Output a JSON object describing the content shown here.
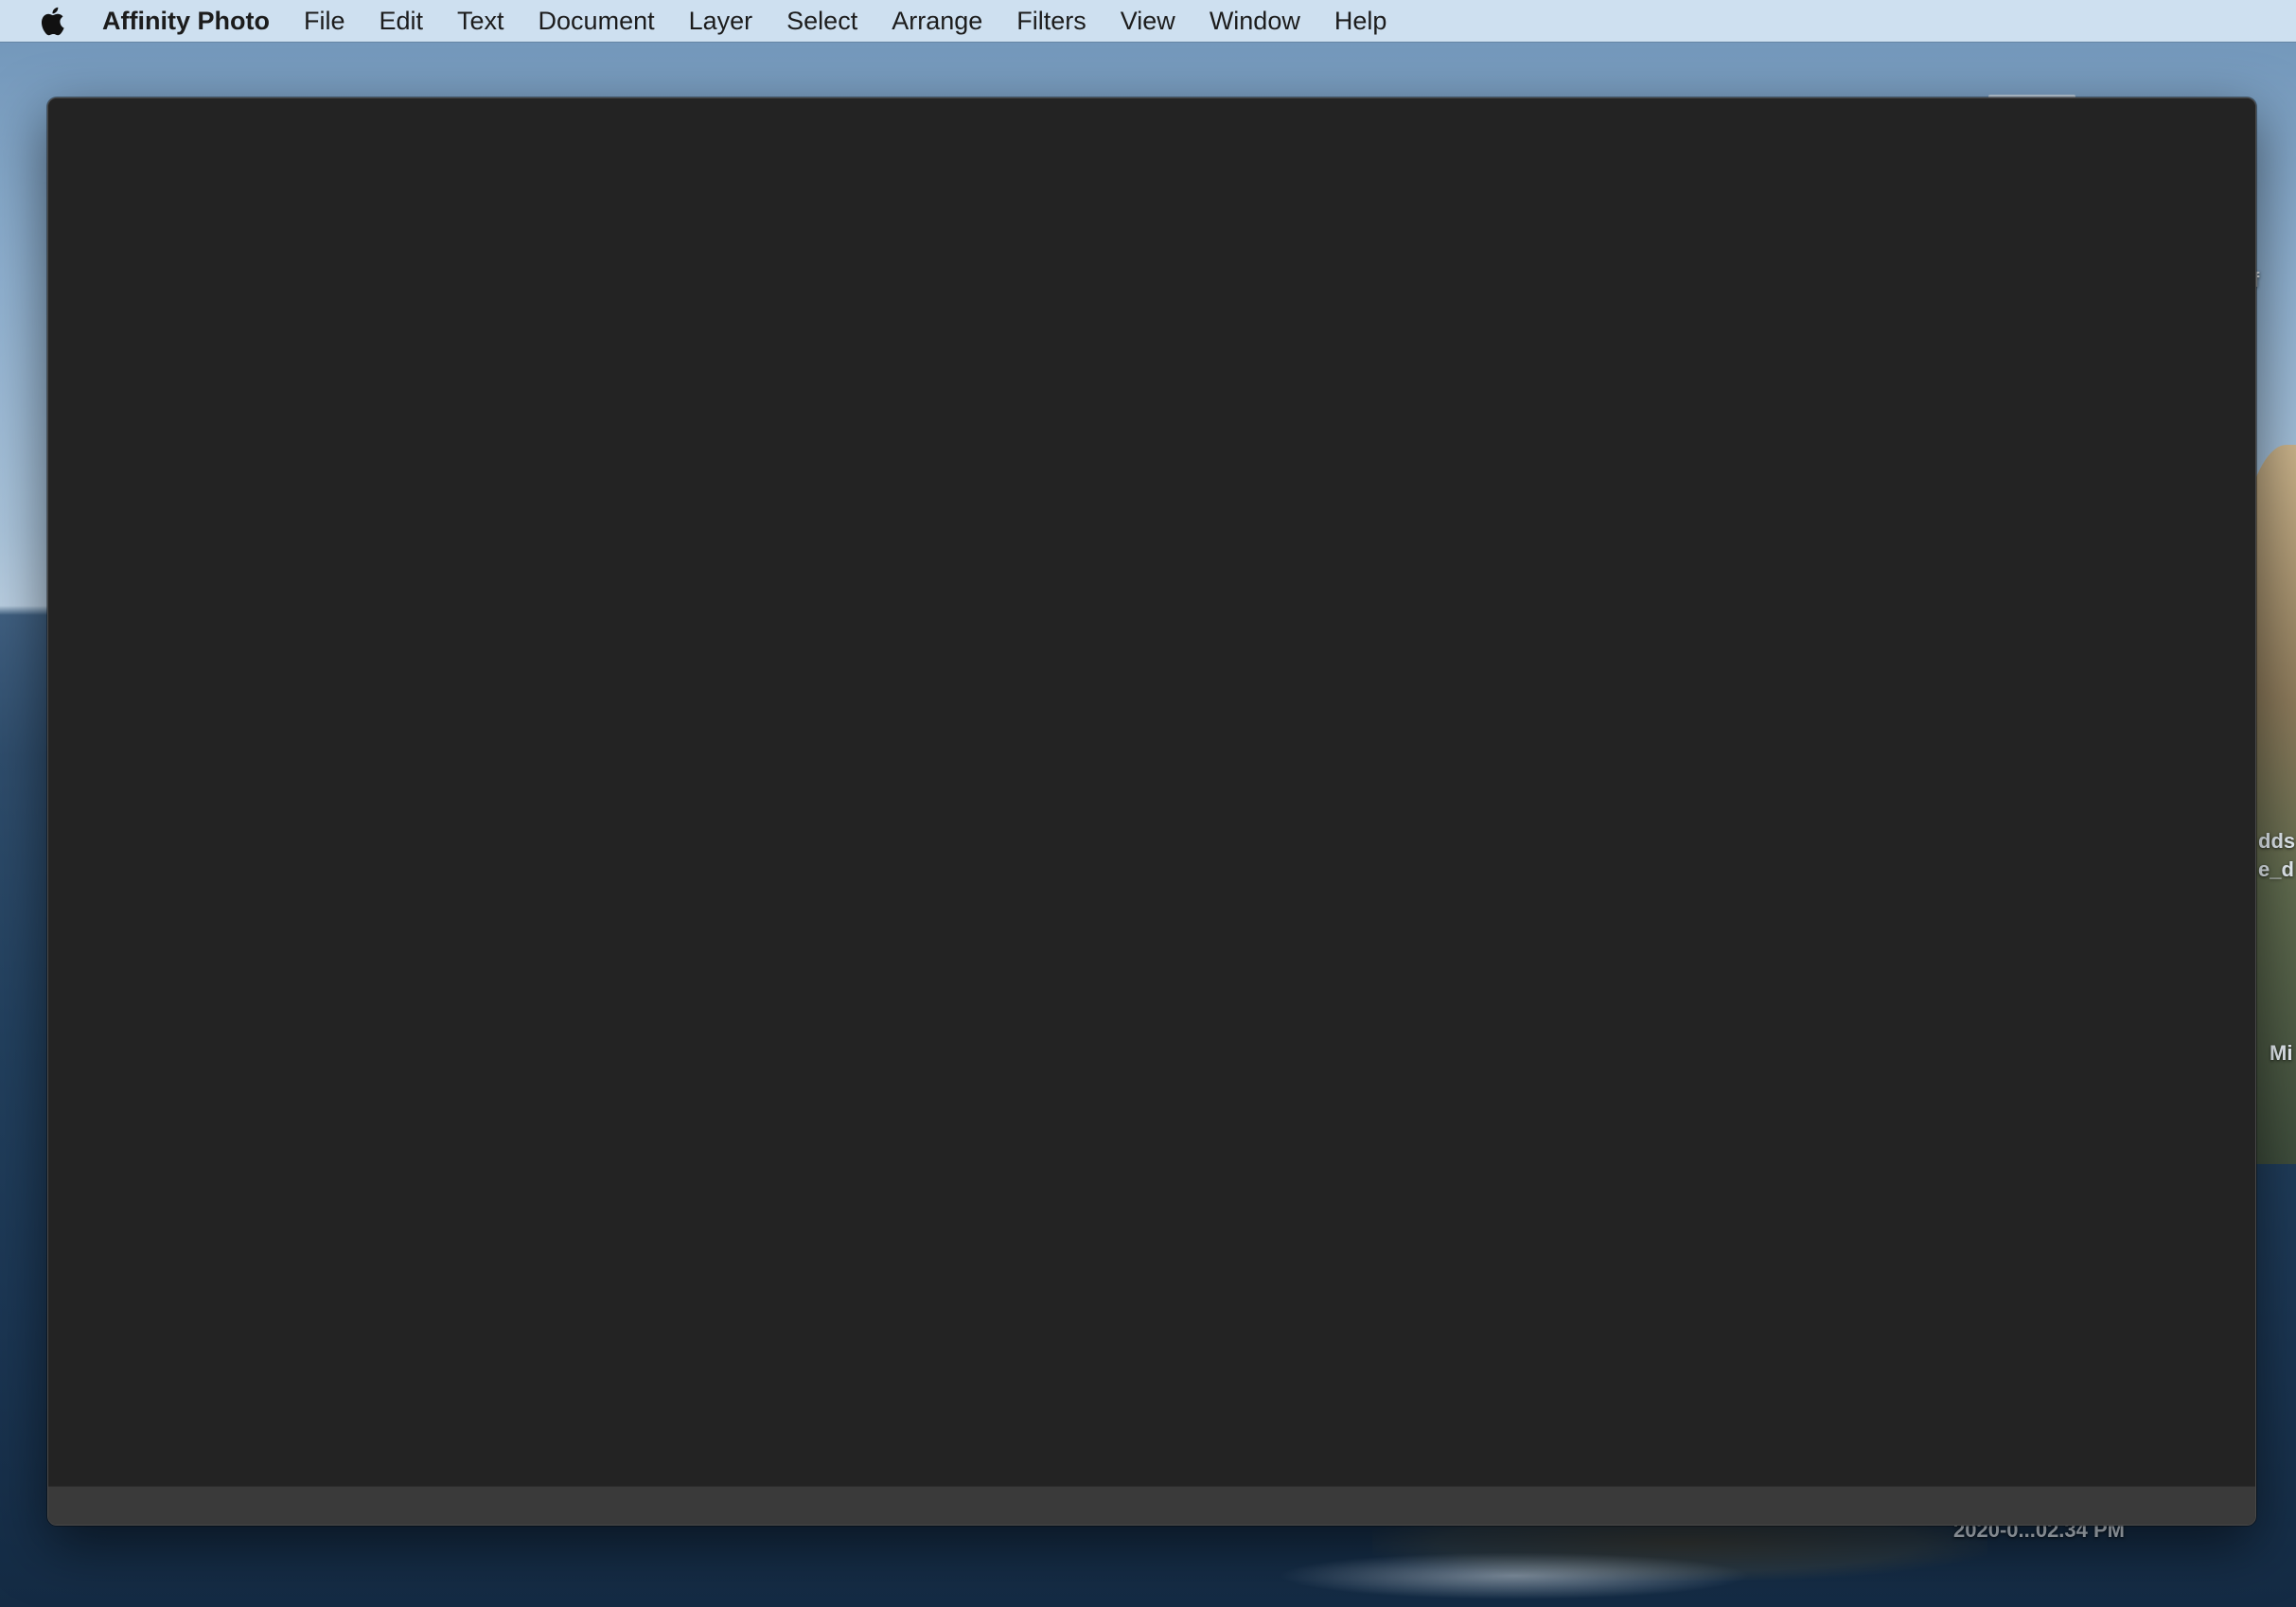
{
  "menubar": {
    "apple_icon": "apple-logo-icon",
    "app_name": "Affinity Photo",
    "items": [
      "File",
      "Edit",
      "Text",
      "Document",
      "Layer",
      "Select",
      "Arrange",
      "Filters",
      "View",
      "Window",
      "Help"
    ]
  },
  "desktop": {
    "labels": {
      "f": "f",
      "dds": "dds",
      "e_d": "e_d",
      "mi": "Mi",
      "screenshot": "2020-0...02.34 PM"
    }
  },
  "window": {
    "background": "#232323",
    "status_bar_color": "#3a3a3a"
  }
}
